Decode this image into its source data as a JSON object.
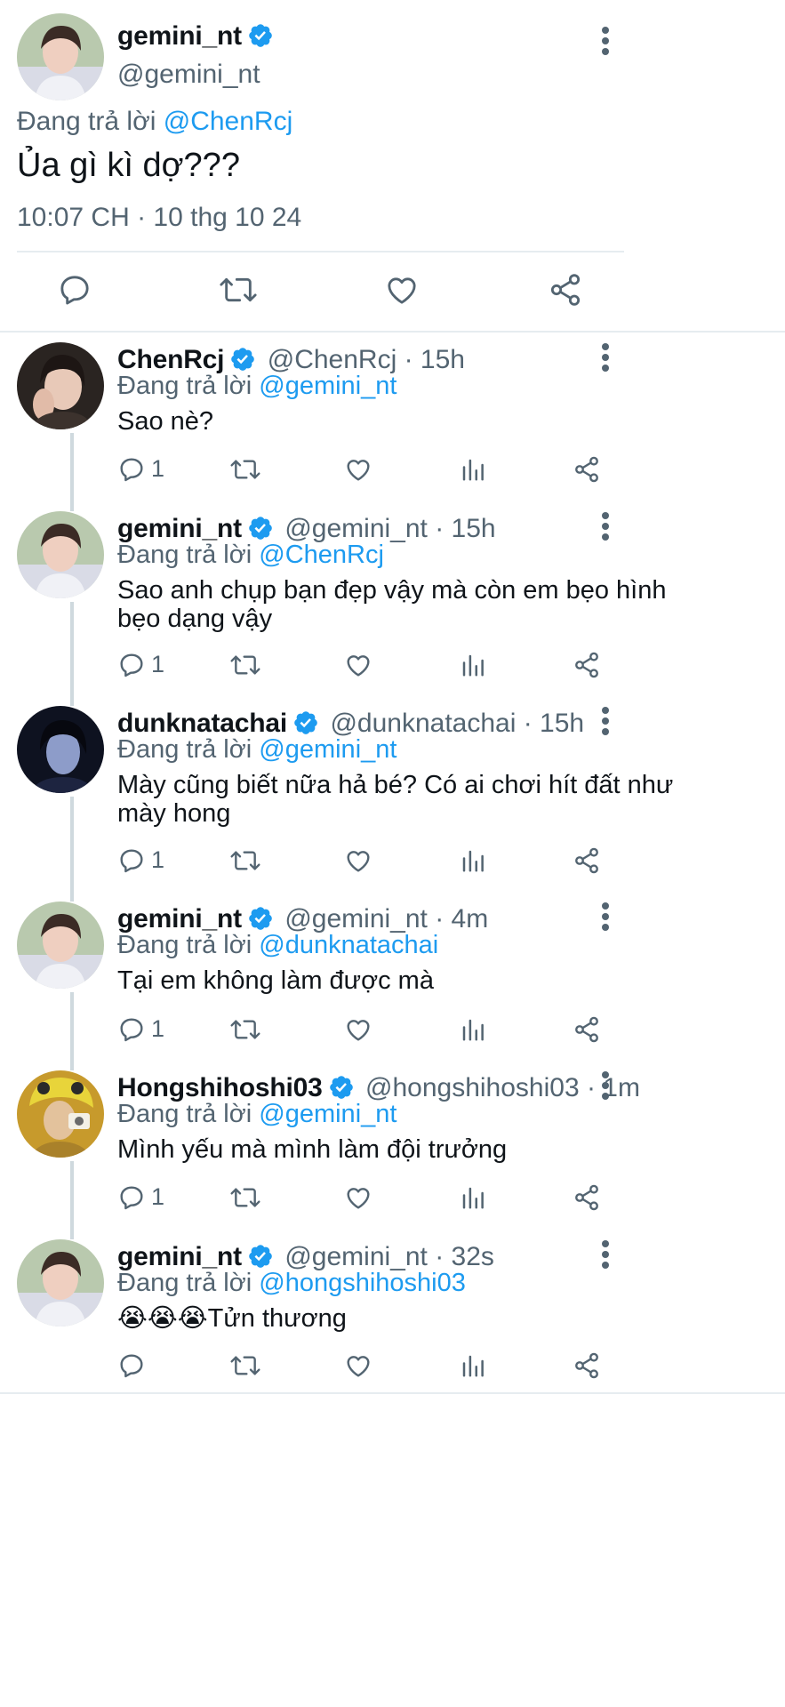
{
  "main_tweet": {
    "display_name": "gemini_nt",
    "handle": "@gemini_nt",
    "replying_prefix": "Đang trả lời",
    "replying_to": "@ChenRcj",
    "text": "Ủa gì kì dợ???",
    "timestamp": "10:07 CH · 10 thg 10 24"
  },
  "replies": [
    {
      "display_name": "ChenRcj",
      "handle_time": "@ChenRcj · 15h",
      "replying_prefix": "Đang trả lời",
      "replying_to": "@gemini_nt",
      "text_line1": "Sao nè?",
      "text_line2": "",
      "reply_count": "1"
    },
    {
      "display_name": "gemini_nt",
      "handle_time": "@gemini_nt · 15h",
      "replying_prefix": "Đang trả lời",
      "replying_to": "@ChenRcj",
      "text_line1": "Sao anh chụp bạn đẹp vậy mà còn em bẹo hình",
      "text_line2": "bẹo dạng vậy",
      "reply_count": "1"
    },
    {
      "display_name": "dunknatachai",
      "handle_time": "@dunknatachai · 15h",
      "replying_prefix": "Đang trả lời",
      "replying_to": "@gemini_nt",
      "text_line1": "Mày cũng biết nữa hả bé? Có ai chơi hít đất như",
      "text_line2": "mày hong",
      "reply_count": "1"
    },
    {
      "display_name": "gemini_nt",
      "handle_time": "@gemini_nt · 4m",
      "replying_prefix": "Đang trả lời",
      "replying_to": "@dunknatachai",
      "text_line1": "Tại em không làm được mà",
      "text_line2": "",
      "reply_count": "1"
    },
    {
      "display_name": "Hongshihoshi03",
      "handle_time": "@hongshihoshi03 · 1m",
      "replying_prefix": "Đang trả lời",
      "replying_to": "@gemini_nt",
      "text_line1": "Mình yếu mà mình làm đội trưởng",
      "text_line2": "",
      "reply_count": "1"
    },
    {
      "display_name": "gemini_nt",
      "handle_time": "@gemini_nt · 32s",
      "replying_prefix": "Đang trả lời",
      "replying_to": "@hongshihoshi03",
      "text_line1": "😭😭😭Tửn thương",
      "text_line2": "",
      "reply_count": ""
    }
  ],
  "icons": {
    "reply": "reply-icon",
    "retweet": "retweet-icon",
    "like": "like-icon",
    "views": "views-icon",
    "share": "share-icon",
    "verified": "verified-badge-icon",
    "more": "more-options-icon"
  },
  "colors": {
    "link": "#1d9bf0",
    "muted": "#536471",
    "verified": "#1d9bf0",
    "thread_line": "#cfd9de"
  }
}
